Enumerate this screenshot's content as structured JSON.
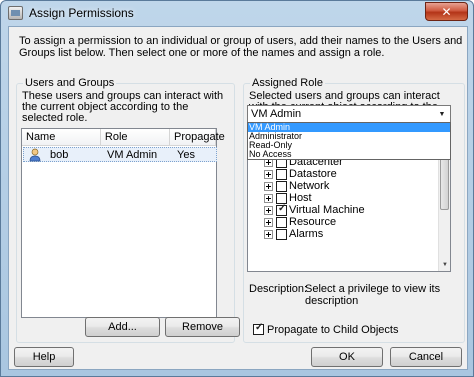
{
  "window": {
    "title": "Assign Permissions",
    "close_glyph": "✕",
    "intro_text": "To assign a permission to an individual or group of users, add their names to the Users and Groups list below. Then select one or more of the names and assign a role."
  },
  "users_groups": {
    "group_title": "Users and Groups",
    "description": "These users and groups can interact with the current object according to the selected role.",
    "columns": [
      "Name",
      "Role",
      "Propagate"
    ],
    "rows": [
      {
        "name": "bob",
        "role": "VM Admin",
        "propagate": "Yes",
        "icon": "user-icon"
      }
    ],
    "add_button": "Add...",
    "remove_button": "Remove"
  },
  "assigned_role": {
    "group_title": "Assigned Role",
    "description": "Selected users and groups can interact with the current object according to the chosen role and privileges.",
    "selected_role": "VM Admin",
    "role_options": [
      "VM Admin",
      "Administrator",
      "Read-Only",
      "No Access"
    ],
    "privileges": [
      {
        "label": "Datacenter",
        "checked": false
      },
      {
        "label": "Datastore",
        "checked": false
      },
      {
        "label": "Network",
        "checked": false
      },
      {
        "label": "Host",
        "checked": false
      },
      {
        "label": "Virtual Machine",
        "checked": true
      },
      {
        "label": "Resource",
        "checked": false
      },
      {
        "label": "Alarms",
        "checked": false
      }
    ],
    "description_label": "Description:",
    "description_value": "Select a privilege to view its description",
    "propagate_label": "Propagate to Child Objects",
    "propagate_checked": true
  },
  "footer": {
    "help_button": "Help",
    "ok_button": "OK",
    "cancel_button": "Cancel"
  },
  "colors": {
    "title_bar": "#bfd6ea",
    "selection": "#3399ff",
    "close_button": "#c8462b"
  }
}
